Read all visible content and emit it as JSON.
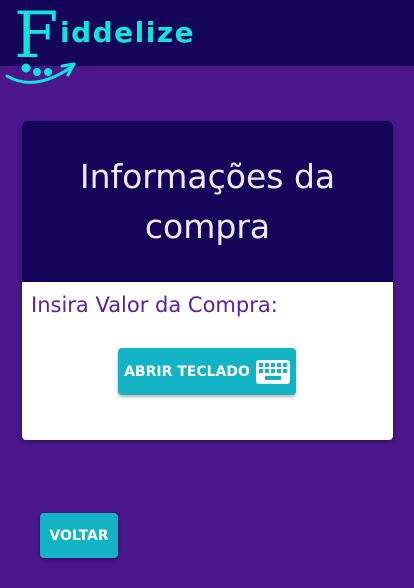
{
  "brand": {
    "logo_initial": "F",
    "logo_rest": "iddelize",
    "color_primary": "#14045a",
    "color_background": "#4a168a",
    "color_accent": "#11e3df",
    "color_button": "#13b3c6"
  },
  "card": {
    "title": "Informações da compra",
    "purchase_value_label": "Insira Valor da Compra:",
    "open_keyboard_button": {
      "label": "ABRIR TECLADO",
      "icon": "keyboard-icon"
    }
  },
  "footer": {
    "back_button_label": "VOLTAR"
  }
}
